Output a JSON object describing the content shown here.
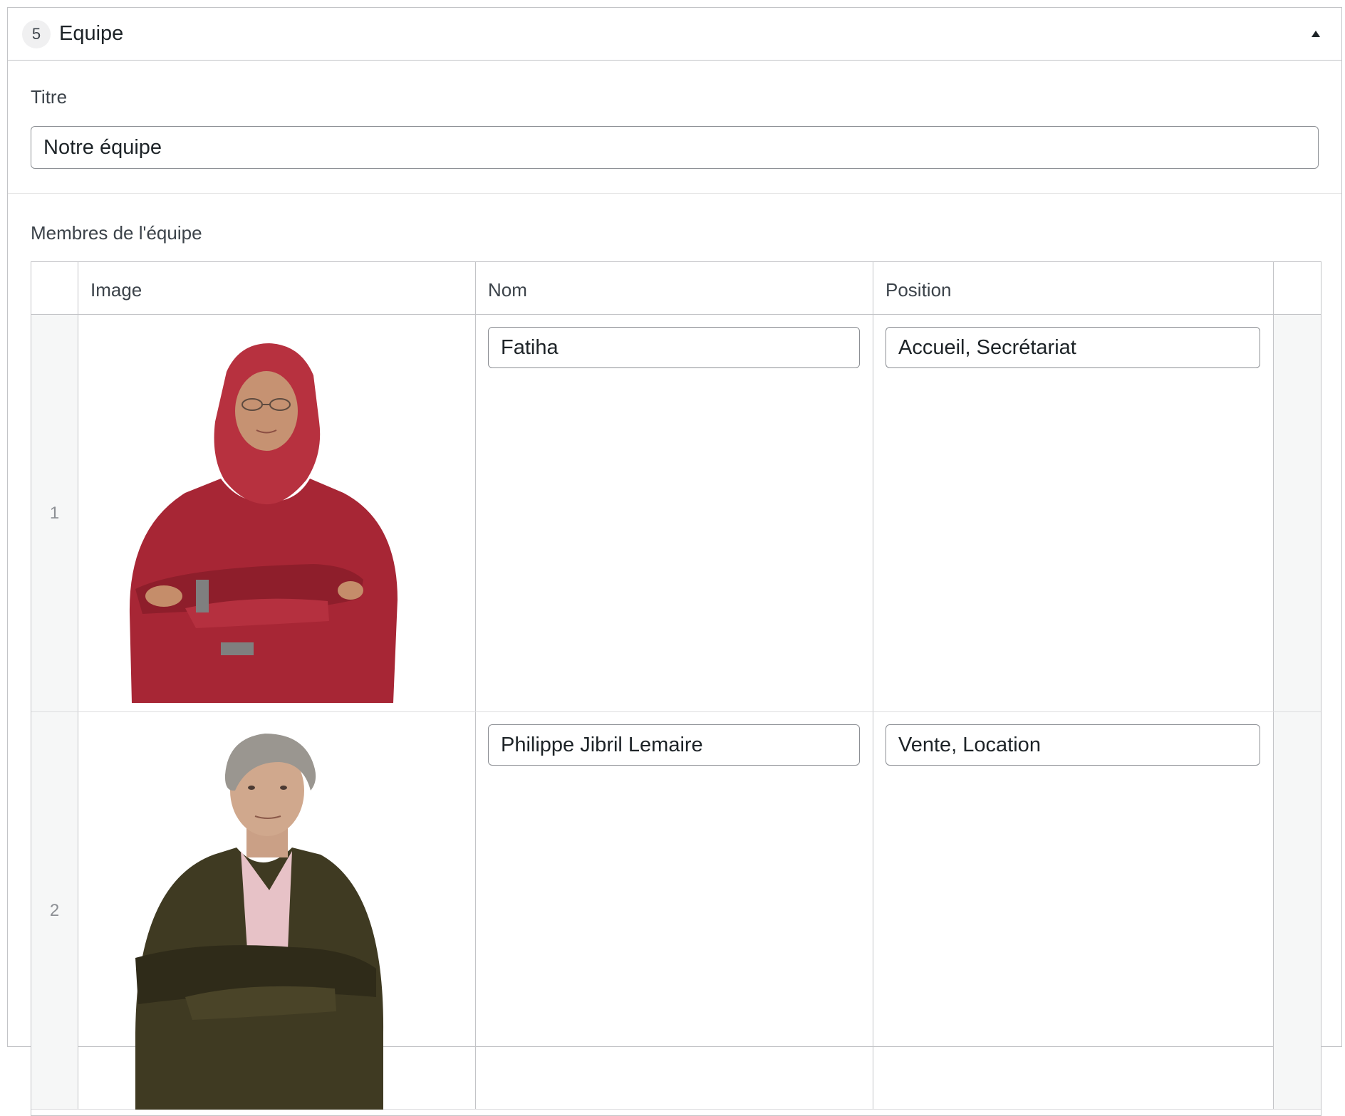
{
  "section": {
    "index": "5",
    "title": "Equipe",
    "collapse_icon": "triangle-up-icon"
  },
  "title_field": {
    "label": "Titre",
    "value": "Notre équipe"
  },
  "members_field": {
    "label": "Membres de l'équipe",
    "columns": [
      "Image",
      "Nom",
      "Position"
    ],
    "rows": [
      {
        "number": "1",
        "image": "member-photo-woman-red-hijab",
        "nom": "Fatiha",
        "position": "Accueil, Secrétariat"
      },
      {
        "number": "2",
        "image": "member-photo-man-gray-hair",
        "nom": "Philippe Jibril Lemaire",
        "position": "Vente, Location"
      }
    ]
  },
  "colors": {
    "border": "#c3c4c7",
    "input_border": "#8c8f94",
    "handle_bg": "#f6f7f7",
    "text": "#1d2327",
    "photo_woman_top": "#a72635",
    "photo_man_jacket": "#3f3a22"
  }
}
